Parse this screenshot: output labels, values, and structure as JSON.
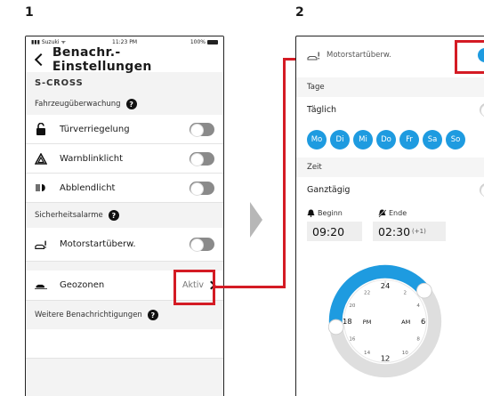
{
  "steps": [
    "1",
    "2"
  ],
  "phone1": {
    "status": {
      "carrier": "Suzuki",
      "time": "11:23 PM",
      "battery": "100%"
    },
    "title": "Benachr.-Einstellungen",
    "model": "S-CROSS",
    "sections": {
      "vehicle": "Fahrzeugüberwachung",
      "security": "Sicherheitsalarme",
      "more": "Weitere Benachrichtigungen"
    },
    "rows": {
      "door": "Türverriegelung",
      "hazard": "Warnblinklicht",
      "lowbeam": "Abblendlicht",
      "engine": "Motorstartüberw.",
      "geofence": "Geozonen",
      "geofence_value": "Aktiv"
    },
    "help": "?"
  },
  "phone2": {
    "engine_label": "Motorstartüberw.",
    "days_section": "Tage",
    "daily": "Täglich",
    "days": [
      "Mo",
      "Di",
      "Mi",
      "Do",
      "Fr",
      "Sa",
      "So"
    ],
    "time_section": "Zeit",
    "all_day": "Ganztägig",
    "begin_label": "Beginn",
    "end_label": "Ende",
    "begin_time": "09:20",
    "end_time": "02:30",
    "end_suffix": "(+1)",
    "dial": {
      "top": "24",
      "bottom": "12",
      "left": "18",
      "right": "6",
      "pm": "PM",
      "am": "AM",
      "n22": "22",
      "n2": "2",
      "n20": "20",
      "n4": "4",
      "n16": "16",
      "n8": "8",
      "n14": "14",
      "n10": "10"
    }
  },
  "colors": {
    "accent": "#1e9be0",
    "highlight": "#d41b24"
  }
}
